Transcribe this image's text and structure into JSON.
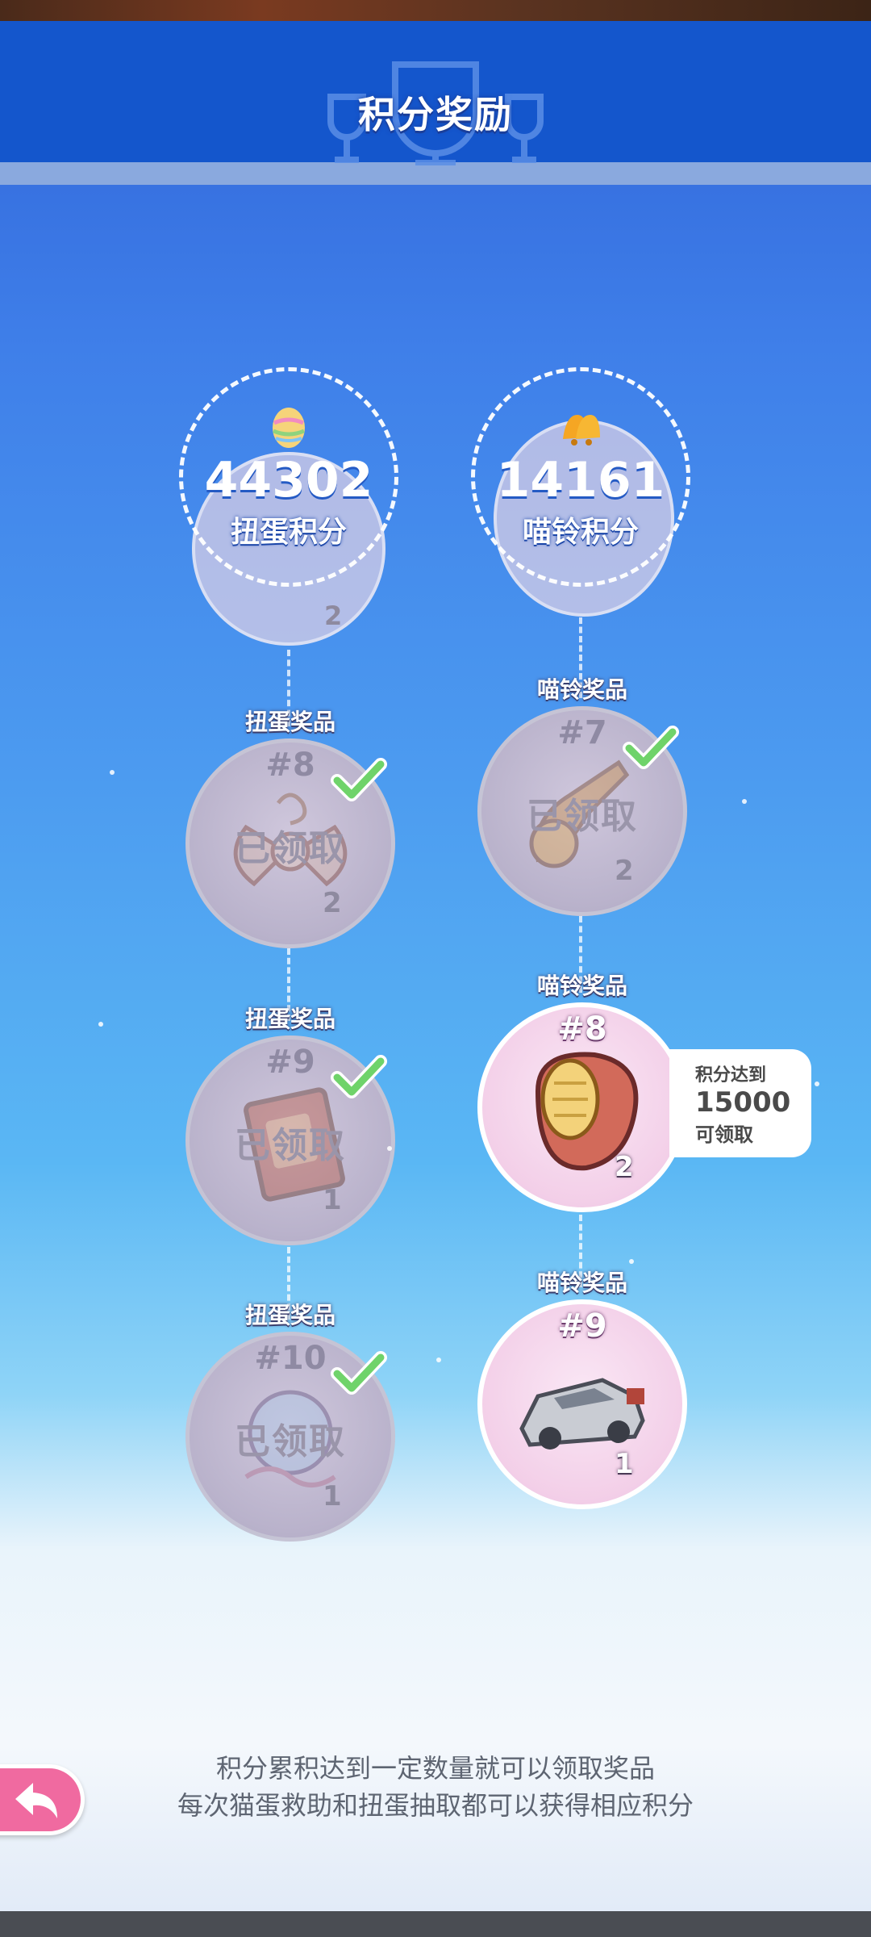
{
  "header": {
    "title": "积分奖励"
  },
  "scores": [
    {
      "icon": "easter-egg-icon",
      "value": "44302",
      "label": "扭蛋积分"
    },
    {
      "icon": "bell-icon",
      "value": "14161",
      "label": "喵铃积分"
    }
  ],
  "partial_above": {
    "left_count": "2"
  },
  "left_column": [
    {
      "tag": "扭蛋奖品",
      "num": "#8",
      "count": "2",
      "status": "已领取",
      "icon": "bow-accessory-icon"
    },
    {
      "tag": "扭蛋奖品",
      "num": "#9",
      "count": "1",
      "status": "已领取",
      "icon": "book-icon"
    },
    {
      "tag": "扭蛋奖品",
      "num": "#10",
      "count": "1",
      "status": "已领取",
      "icon": "orb-ornament-icon"
    }
  ],
  "right_column": [
    {
      "tag": "喵铃奖品",
      "num": "#7",
      "count": "2",
      "status": "已领取",
      "icon": "bell-charm-icon"
    },
    {
      "tag": "喵铃奖品",
      "num": "#8",
      "count": "2",
      "icon": "corn-ring-icon"
    },
    {
      "tag": "喵铃奖品",
      "num": "#9",
      "count": "1",
      "icon": "silver-car-icon"
    }
  ],
  "requirement": {
    "line1": "积分达到",
    "line2": "15000",
    "line3": "可领取"
  },
  "footer": {
    "line1": "积分累积达到一定数量就可以领取奖品",
    "line2": "每次猫蛋救助和扭蛋抽取都可以获得相应积分"
  },
  "back_button": {
    "icon": "back-arrow-icon"
  },
  "colors": {
    "header": "#1456cc",
    "accent_pink": "#f06aa0",
    "check_green": "#6fd36a"
  }
}
